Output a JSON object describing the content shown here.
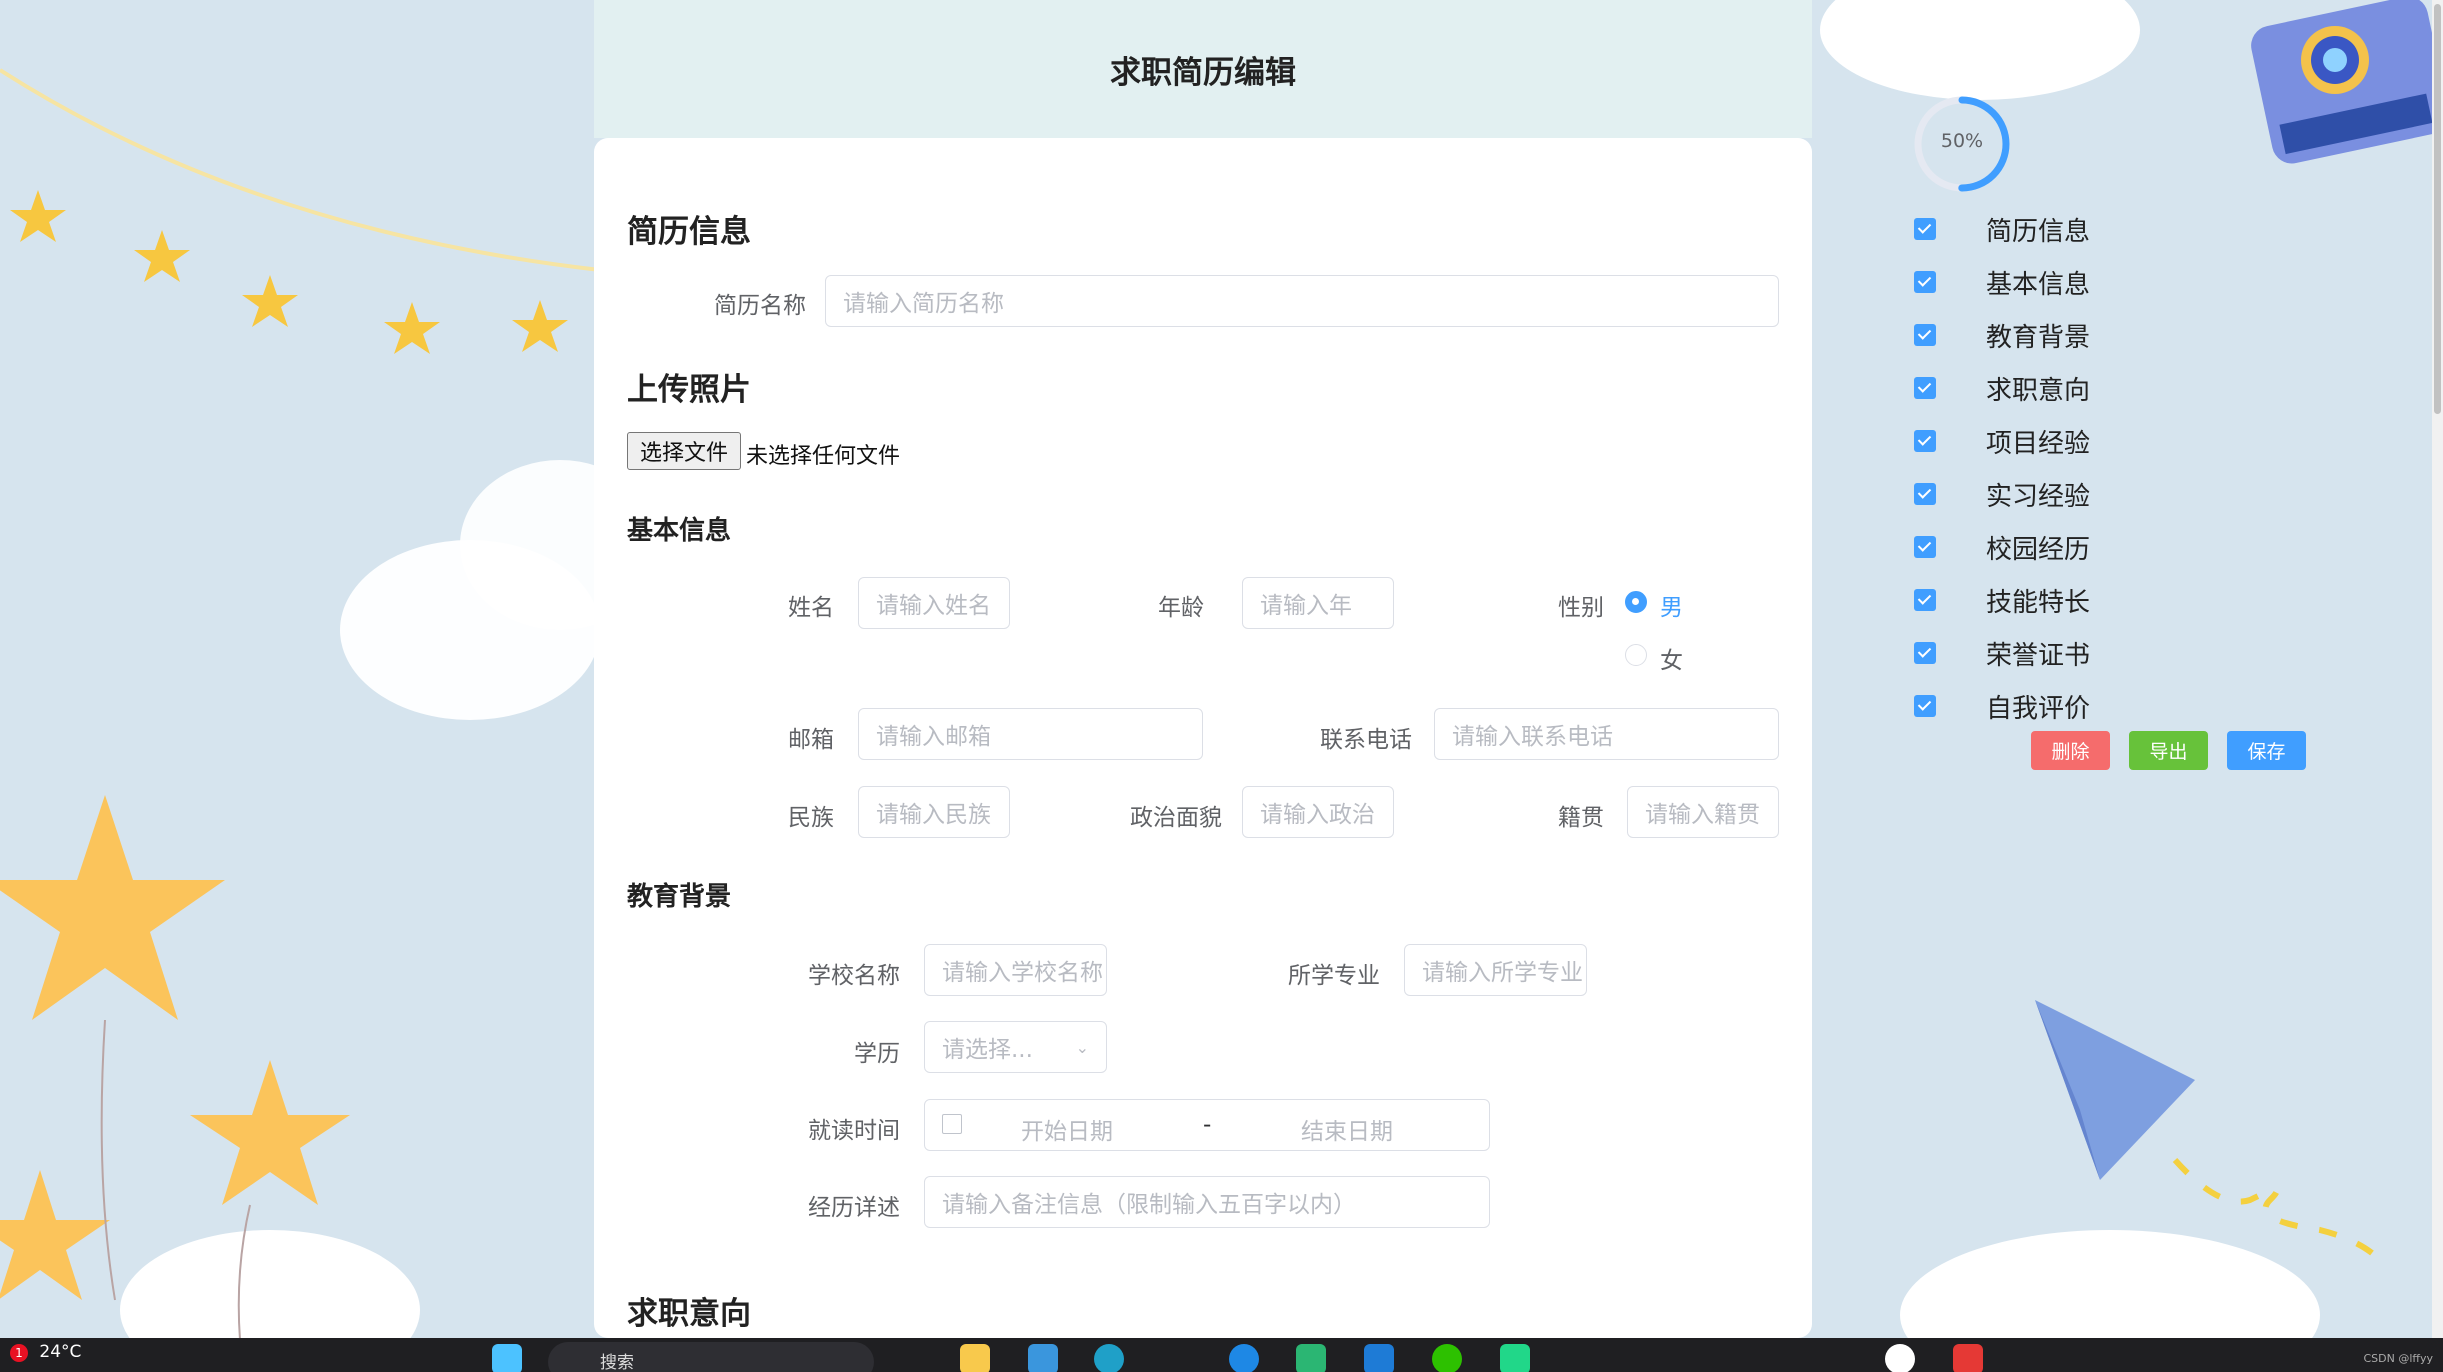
{
  "page": {
    "title": "求职简历编辑"
  },
  "resume_info": {
    "title": "简历信息",
    "name_label": "简历名称",
    "name_placeholder": "请输入简历名称"
  },
  "photo": {
    "title": "上传照片",
    "choose_button": "选择文件",
    "no_file_text": "未选择任何文件"
  },
  "basic": {
    "title": "基本信息",
    "name_label": "姓名",
    "name_placeholder": "请输入姓名",
    "age_label": "年龄",
    "age_placeholder": "请输入年",
    "gender_label": "性别",
    "gender_male": "男",
    "gender_female": "女",
    "gender_selected": "男",
    "email_label": "邮箱",
    "email_placeholder": "请输入邮箱",
    "phone_label": "联系电话",
    "phone_placeholder": "请输入联系电话",
    "ethnicity_label": "民族",
    "ethnicity_placeholder": "请输入民族",
    "political_label": "政治面貌",
    "political_placeholder": "请输入政治",
    "hometown_label": "籍贯",
    "hometown_placeholder": "请输入籍贯"
  },
  "education": {
    "title": "教育背景",
    "school_label": "学校名称",
    "school_placeholder": "请输入学校名称",
    "major_label": "所学专业",
    "major_placeholder": "请输入所学专业",
    "degree_label": "学历",
    "degree_placeholder": "请选择...",
    "period_label": "就读时间",
    "start_placeholder": "开始日期",
    "separator": "-",
    "end_placeholder": "结束日期",
    "detail_label": "经历详述",
    "detail_placeholder": "请输入备注信息（限制输入五百字以内）"
  },
  "job_intent": {
    "title": "求职意向"
  },
  "sidebar": {
    "progress_text": "50%",
    "progress_value": 0.5,
    "items": [
      {
        "label": "简历信息",
        "checked": true
      },
      {
        "label": "基本信息",
        "checked": true
      },
      {
        "label": "教育背景",
        "checked": true
      },
      {
        "label": "求职意向",
        "checked": true
      },
      {
        "label": "项目经验",
        "checked": true
      },
      {
        "label": "实习经验",
        "checked": true
      },
      {
        "label": "校园经历",
        "checked": true
      },
      {
        "label": "技能特长",
        "checked": true
      },
      {
        "label": "荣誉证书",
        "checked": true
      },
      {
        "label": "自我评价",
        "checked": true
      }
    ],
    "delete_button": "删除",
    "export_button": "导出",
    "save_button": "保存",
    "colors": {
      "delete": "#f56c6c",
      "export": "#67c23a",
      "save": "#409eff"
    }
  },
  "taskbar": {
    "weather_badge": "1",
    "temperature": "24°C",
    "search_text": "搜索"
  },
  "watermark": "CSDN @lffyy"
}
